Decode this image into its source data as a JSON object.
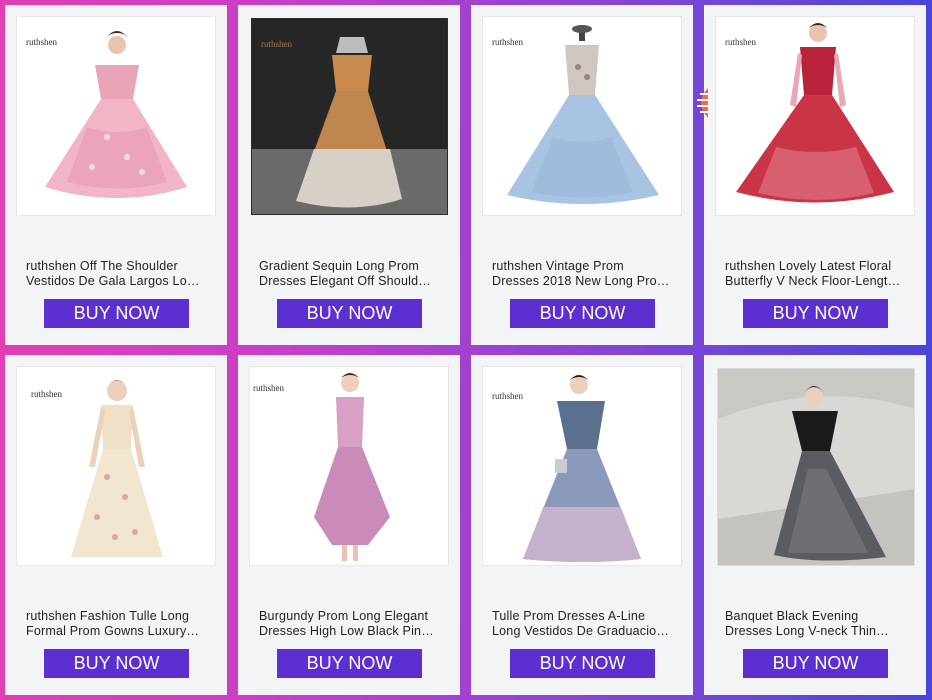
{
  "products": [
    {
      "watermark": "ruthshen",
      "title_line1": "ruthshen Off The Shoulder",
      "title_line2": "Vestidos De Gala Largos Lo…",
      "buy_label": "BUY NOW",
      "image_icon": "pink-ball-gown-image"
    },
    {
      "watermark": "ruthshen",
      "title_line1": "Gradient Sequin Long Prom",
      "title_line2": "Dresses Elegant Off Should…",
      "buy_label": "BUY NOW",
      "image_icon": "gold-sequin-gown-image"
    },
    {
      "watermark": "ruthshen",
      "title_line1": "ruthshen Vintage Prom",
      "title_line2": "Dresses 2018 New Long Pro…",
      "buy_label": "BUY NOW",
      "image_icon": "blue-ball-gown-image"
    },
    {
      "watermark": "ruthshen",
      "title_line1": "ruthshen Lovely Latest Floral",
      "title_line2": "Butterfly V Neck Floor-Lengt…",
      "buy_label": "BUY NOW",
      "image_icon": "red-ball-gown-image"
    },
    {
      "watermark": "ruthshen",
      "title_line1": "ruthshen Fashion Tulle Long",
      "title_line2": "Formal Prom Gowns Luxury…",
      "buy_label": "BUY NOW",
      "image_icon": "champagne-tulle-gown-image"
    },
    {
      "watermark": "ruthshen",
      "title_line1": "Burgundy Prom Long Elegant",
      "title_line2": "Dresses High Low Black Pin…",
      "buy_label": "BUY NOW",
      "image_icon": "pink-high-low-dress-image"
    },
    {
      "watermark": "ruthshen",
      "title_line1": "Tulle Prom Dresses A-Line",
      "title_line2": "Long Vestidos De Graduacio…",
      "buy_label": "BUY NOW",
      "image_icon": "ombre-blue-gown-image"
    },
    {
      "watermark": "",
      "title_line1": "Banquet Black Evening",
      "title_line2": "Dresses Long V-neck Thin…",
      "buy_label": "BUY NOW",
      "image_icon": "black-evening-dress-image"
    }
  ],
  "colors": {
    "buy_button": "#5b2fd0",
    "card_background": "#f3f4f6",
    "page_gradient_start": "#e13fb3",
    "page_gradient_end": "#4a44d8"
  }
}
